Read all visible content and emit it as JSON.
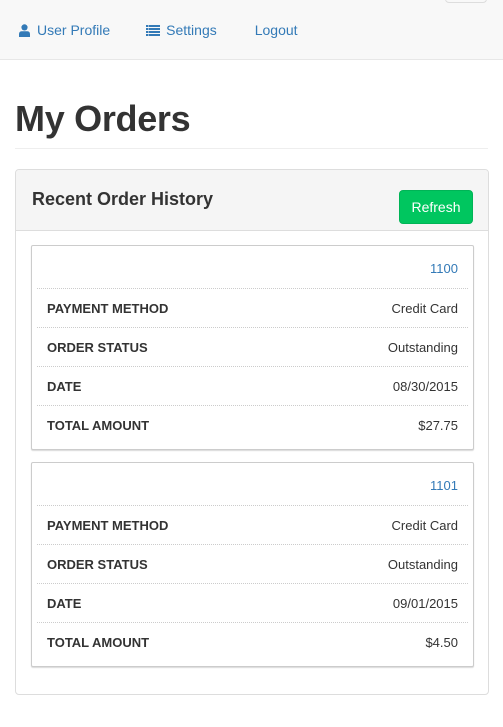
{
  "nav": {
    "items": [
      {
        "label": "User Profile",
        "icon": "user-icon"
      },
      {
        "label": "Settings",
        "icon": "settings-icon"
      },
      {
        "label": "Logout"
      }
    ]
  },
  "page": {
    "title": "My Orders"
  },
  "panel": {
    "title": "Recent Order History",
    "refresh_label": "Refresh"
  },
  "orders": [
    {
      "id": "1100",
      "rows": [
        {
          "label": "PAYMENT METHOD",
          "value": "Credit Card"
        },
        {
          "label": "ORDER STATUS",
          "value": "Outstanding"
        },
        {
          "label": "DATE",
          "value": "08/30/2015"
        },
        {
          "label": "TOTAL AMOUNT",
          "value": "$27.75"
        }
      ]
    },
    {
      "id": "1101",
      "rows": [
        {
          "label": "PAYMENT METHOD",
          "value": "Credit Card"
        },
        {
          "label": "ORDER STATUS",
          "value": "Outstanding"
        },
        {
          "label": "DATE",
          "value": "09/01/2015"
        },
        {
          "label": "TOTAL AMOUNT",
          "value": "$4.50"
        }
      ]
    }
  ],
  "colors": {
    "link": "#337ab7",
    "refresh_button": "#00c65f"
  }
}
